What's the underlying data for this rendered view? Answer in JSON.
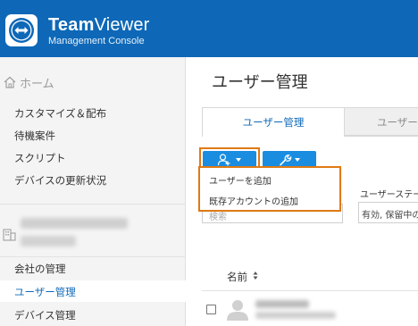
{
  "header": {
    "brand_bold": "Team",
    "brand_regular": "Viewer",
    "subtitle": "Management Console",
    "logo_icon": "teamviewer-arrows-icon",
    "bg_color": "#0e68b7"
  },
  "sidebar": {
    "home_label": "ホーム",
    "items_top": [
      "カスタマイズ＆配布",
      "待機案件",
      "スクリプト",
      "デバイスの更新状況"
    ],
    "items_bottom": [
      "会社の管理",
      "ユーザー管理",
      "デバイス管理"
    ],
    "active_item": "ユーザー管理"
  },
  "main": {
    "title": "ユーザー管理",
    "tabs": [
      "ユーザー管理",
      "ユーザーグ"
    ],
    "add_user_dropdown": {
      "items": [
        "ユーザーを追加",
        "既存アカウントの追加"
      ]
    },
    "search_placeholder": "検索",
    "status_filter": {
      "label": "ユーザーステー",
      "value": "有効, 保留中の"
    },
    "table": {
      "column_name": "名前"
    }
  },
  "colors": {
    "accent": "#1a8de0",
    "highlight": "#e07a14",
    "active_tab_text": "#0e68b7"
  }
}
